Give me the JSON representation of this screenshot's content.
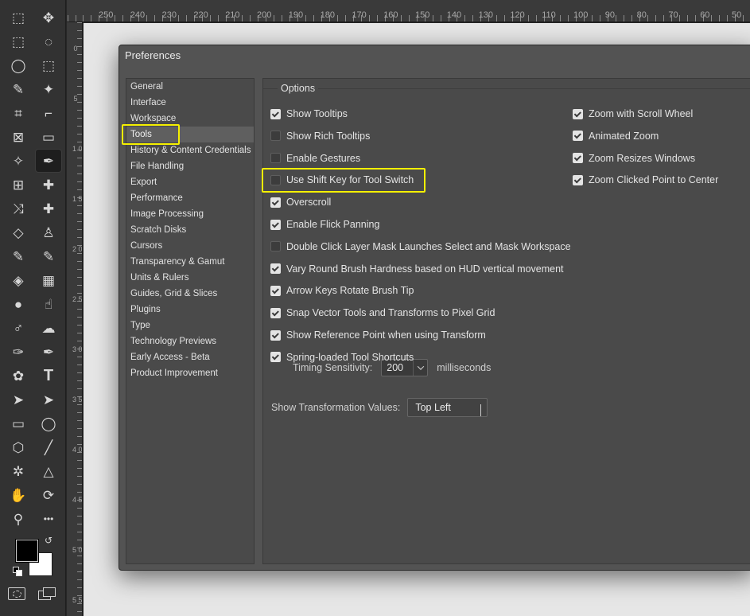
{
  "dialog": {
    "title": "Preferences",
    "categories": [
      {
        "label": "General"
      },
      {
        "label": "Interface"
      },
      {
        "label": "Workspace"
      },
      {
        "label": "Tools"
      },
      {
        "label": "History & Content Credentials"
      },
      {
        "label": "File Handling"
      },
      {
        "label": "Export"
      },
      {
        "label": "Performance"
      },
      {
        "label": "Image Processing"
      },
      {
        "label": "Scratch Disks"
      },
      {
        "label": "Cursors"
      },
      {
        "label": "Transparency & Gamut"
      },
      {
        "label": "Units & Rulers"
      },
      {
        "label": "Guides, Grid & Slices"
      },
      {
        "label": "Plugins"
      },
      {
        "label": "Type"
      },
      {
        "label": "Technology Previews"
      },
      {
        "label": "Early Access - Beta"
      },
      {
        "label": "Product Improvement"
      }
    ],
    "selected_category": "Tools",
    "options": {
      "legend": "Options",
      "left_column": [
        {
          "label": "Show Tooltips",
          "checked": true
        },
        {
          "label": "Show Rich Tooltips",
          "checked": false
        },
        {
          "label": "Enable Gestures",
          "checked": false
        },
        {
          "label": "Use Shift Key for Tool Switch",
          "checked": false
        },
        {
          "label": "Overscroll",
          "checked": true
        },
        {
          "label": "Enable Flick Panning",
          "checked": true
        },
        {
          "label": "Double Click Layer Mask Launches Select and Mask Workspace",
          "checked": false
        },
        {
          "label": "Vary Round Brush Hardness based on HUD vertical movement",
          "checked": true
        },
        {
          "label": "Arrow Keys Rotate Brush Tip",
          "checked": true
        },
        {
          "label": "Snap Vector Tools and Transforms to Pixel Grid",
          "checked": true
        },
        {
          "label": "Show Reference Point when using Transform",
          "checked": true
        },
        {
          "label": "Spring-loaded Tool Shortcuts",
          "checked": true
        }
      ],
      "right_column": [
        {
          "label": "Zoom with Scroll Wheel",
          "checked": true
        },
        {
          "label": "Animated Zoom",
          "checked": true
        },
        {
          "label": "Zoom Resizes Windows",
          "checked": true
        },
        {
          "label": "Zoom Clicked Point to Center",
          "checked": true
        }
      ],
      "timing_sensitivity": {
        "label": "Timing Sensitivity:",
        "value": "200",
        "unit": "milliseconds"
      }
    },
    "transformation_values": {
      "label": "Show Transformation Values:",
      "value": "Top Left"
    }
  },
  "ruler": {
    "top_labels": [
      "250",
      "240",
      "230",
      "220",
      "210",
      "200",
      "190",
      "180",
      "170",
      "160",
      "150",
      "140",
      "130",
      "120",
      "110",
      "100",
      "90",
      "80",
      "70",
      "60",
      "50"
    ],
    "left_labels": [
      "0",
      "5",
      "1 0",
      "1 5",
      "2 0",
      "2 5",
      "3 0",
      "3 5",
      "4 0",
      "4 5",
      "5 0",
      "5 5"
    ]
  },
  "toolbar": {
    "tools": [
      "artboard-icon",
      "move-icon",
      "rectangular-marquee-icon",
      "elliptical-marquee-icon",
      "lasso-icon",
      "object-selection-icon",
      "quick-selection-icon",
      "magic-wand-icon",
      "perspective-crop-icon",
      "crop-icon",
      "frame-icon",
      "ruler-icon",
      "color-sampler-icon",
      "eyedropper-icon",
      "remove-tool-icon",
      "healing-brush-icon",
      "content-aware-move-icon",
      "patch-icon",
      "eraser-icon",
      "clone-stamp-icon",
      "color-replacement-icon",
      "brush-icon",
      "paint-bucket-icon",
      "gradient-icon",
      "blur-icon",
      "smudge-icon",
      "dodge-icon",
      "sponge-icon",
      "freeform-pen-icon",
      "pen-icon",
      "history-brush-icon",
      "type-icon",
      "direct-selection-icon",
      "path-selection-icon",
      "rectangle-icon",
      "ellipse-icon",
      "polygon-icon",
      "line-icon",
      "custom-shape-icon",
      "triangle-icon",
      "hand-icon",
      "rotate-view-icon",
      "zoom-icon",
      "more-tools-icon"
    ],
    "active_tool": "eyedropper-icon",
    "foreground_color": "#000000",
    "background_color": "#ffffff"
  },
  "colors": {
    "highlight": "#f5f000",
    "dialog_bg": "#535353",
    "panel_bg": "#4a4a4a",
    "canvas": "#e6e6e6"
  }
}
